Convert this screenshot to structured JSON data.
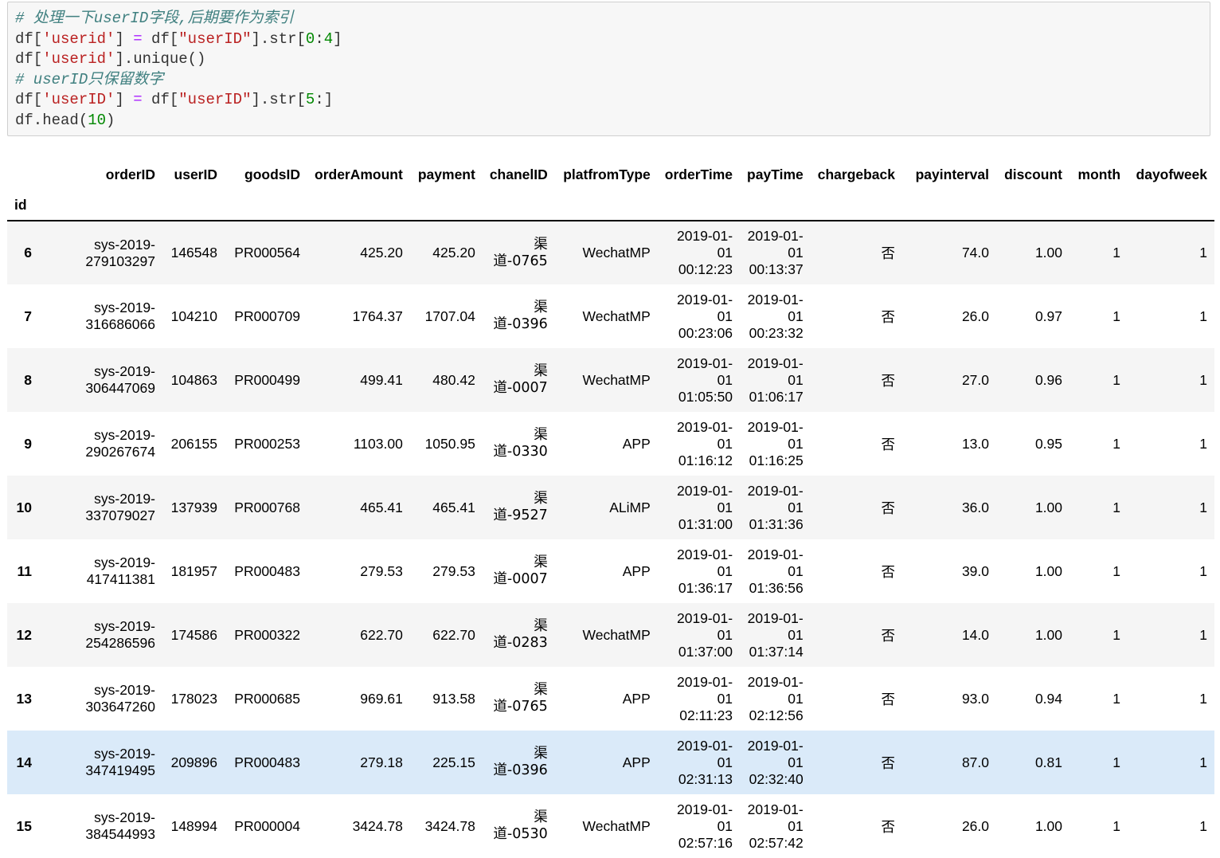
{
  "code_lines": [
    "# 处理一下userID字段,后期要作为索引",
    "df['userid'] = df[\"userID\"].str[0:4]",
    "df['userid'].unique()",
    "# userID只保留数字",
    "df['userID'] = df[\"userID\"].str[5:]",
    "df.head(10)"
  ],
  "table": {
    "index_name": "id",
    "columns": [
      "orderID",
      "userID",
      "goodsID",
      "orderAmount",
      "payment",
      "chanelID",
      "platfromType",
      "orderTime",
      "payTime",
      "chargeback",
      "payinterval",
      "discount",
      "month",
      "dayofweek"
    ],
    "rows": [
      {
        "id": "6",
        "orderID": "sys-2019-279103297",
        "userID": "146548",
        "goodsID": "PR000564",
        "orderAmount": "425.20",
        "payment": "425.20",
        "chanelID": "渠道-0765",
        "platfromType": "WechatMP",
        "orderTime": "2019-01-01 00:12:23",
        "payTime": "2019-01-01 00:13:37",
        "chargeback": "否",
        "payinterval": "74.0",
        "discount": "1.00",
        "month": "1",
        "dayofweek": "1"
      },
      {
        "id": "7",
        "orderID": "sys-2019-316686066",
        "userID": "104210",
        "goodsID": "PR000709",
        "orderAmount": "1764.37",
        "payment": "1707.04",
        "chanelID": "渠道-0396",
        "platfromType": "WechatMP",
        "orderTime": "2019-01-01 00:23:06",
        "payTime": "2019-01-01 00:23:32",
        "chargeback": "否",
        "payinterval": "26.0",
        "discount": "0.97",
        "month": "1",
        "dayofweek": "1"
      },
      {
        "id": "8",
        "orderID": "sys-2019-306447069",
        "userID": "104863",
        "goodsID": "PR000499",
        "orderAmount": "499.41",
        "payment": "480.42",
        "chanelID": "渠道-0007",
        "platfromType": "WechatMP",
        "orderTime": "2019-01-01 01:05:50",
        "payTime": "2019-01-01 01:06:17",
        "chargeback": "否",
        "payinterval": "27.0",
        "discount": "0.96",
        "month": "1",
        "dayofweek": "1"
      },
      {
        "id": "9",
        "orderID": "sys-2019-290267674",
        "userID": "206155",
        "goodsID": "PR000253",
        "orderAmount": "1103.00",
        "payment": "1050.95",
        "chanelID": "渠道-0330",
        "platfromType": "APP",
        "orderTime": "2019-01-01 01:16:12",
        "payTime": "2019-01-01 01:16:25",
        "chargeback": "否",
        "payinterval": "13.0",
        "discount": "0.95",
        "month": "1",
        "dayofweek": "1"
      },
      {
        "id": "10",
        "orderID": "sys-2019-337079027",
        "userID": "137939",
        "goodsID": "PR000768",
        "orderAmount": "465.41",
        "payment": "465.41",
        "chanelID": "渠道-9527",
        "platfromType": "ALiMP",
        "orderTime": "2019-01-01 01:31:00",
        "payTime": "2019-01-01 01:31:36",
        "chargeback": "否",
        "payinterval": "36.0",
        "discount": "1.00",
        "month": "1",
        "dayofweek": "1"
      },
      {
        "id": "11",
        "orderID": "sys-2019-417411381",
        "userID": "181957",
        "goodsID": "PR000483",
        "orderAmount": "279.53",
        "payment": "279.53",
        "chanelID": "渠道-0007",
        "platfromType": "APP",
        "orderTime": "2019-01-01 01:36:17",
        "payTime": "2019-01-01 01:36:56",
        "chargeback": "否",
        "payinterval": "39.0",
        "discount": "1.00",
        "month": "1",
        "dayofweek": "1"
      },
      {
        "id": "12",
        "orderID": "sys-2019-254286596",
        "userID": "174586",
        "goodsID": "PR000322",
        "orderAmount": "622.70",
        "payment": "622.70",
        "chanelID": "渠道-0283",
        "platfromType": "WechatMP",
        "orderTime": "2019-01-01 01:37:00",
        "payTime": "2019-01-01 01:37:14",
        "chargeback": "否",
        "payinterval": "14.0",
        "discount": "1.00",
        "month": "1",
        "dayofweek": "1"
      },
      {
        "id": "13",
        "orderID": "sys-2019-303647260",
        "userID": "178023",
        "goodsID": "PR000685",
        "orderAmount": "969.61",
        "payment": "913.58",
        "chanelID": "渠道-0765",
        "platfromType": "APP",
        "orderTime": "2019-01-01 02:11:23",
        "payTime": "2019-01-01 02:12:56",
        "chargeback": "否",
        "payinterval": "93.0",
        "discount": "0.94",
        "month": "1",
        "dayofweek": "1"
      },
      {
        "id": "14",
        "orderID": "sys-2019-347419495",
        "userID": "209896",
        "goodsID": "PR000483",
        "orderAmount": "279.18",
        "payment": "225.15",
        "chanelID": "渠道-0396",
        "platfromType": "APP",
        "orderTime": "2019-01-01 02:31:13",
        "payTime": "2019-01-01 02:32:40",
        "chargeback": "否",
        "payinterval": "87.0",
        "discount": "0.81",
        "month": "1",
        "dayofweek": "1"
      },
      {
        "id": "15",
        "orderID": "sys-2019-384544993",
        "userID": "148994",
        "goodsID": "PR000004",
        "orderAmount": "3424.78",
        "payment": "3424.78",
        "chanelID": "渠道-0530",
        "platfromType": "WechatMP",
        "orderTime": "2019-01-01 02:57:16",
        "payTime": "2019-01-01 02:57:42",
        "chargeback": "否",
        "payinterval": "26.0",
        "discount": "1.00",
        "month": "1",
        "dayofweek": "1"
      }
    ]
  }
}
